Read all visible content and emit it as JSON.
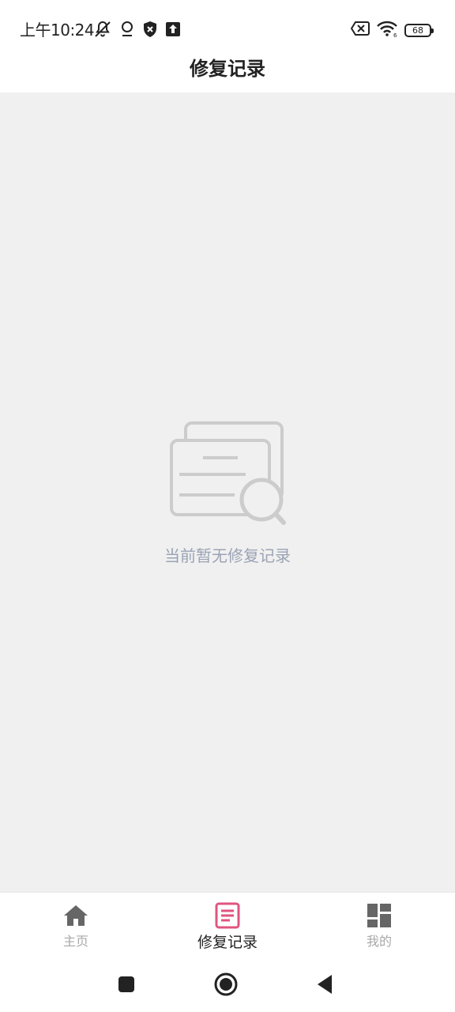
{
  "status_bar": {
    "time": "上午10:24",
    "battery_level": "68",
    "icons": [
      "bell-muted-icon",
      "location-icon",
      "shield-icon",
      "upload-icon",
      "signal-x-icon",
      "wifi-icon",
      "battery-icon"
    ]
  },
  "header": {
    "title": "修复记录"
  },
  "main": {
    "empty_icon": "empty-records-icon",
    "empty_text": "当前暂无修复记录"
  },
  "bottom_nav": {
    "items": [
      {
        "label": "主页",
        "icon": "home-icon",
        "active": false
      },
      {
        "label": "修复记录",
        "icon": "records-icon",
        "active": true
      },
      {
        "label": "我的",
        "icon": "dashboard-icon",
        "active": false
      }
    ],
    "active_color": "#e0557f",
    "inactive_color": "#666666"
  },
  "system_nav": {
    "icons": [
      "recent-apps-icon",
      "home-circle-icon",
      "back-icon"
    ]
  }
}
